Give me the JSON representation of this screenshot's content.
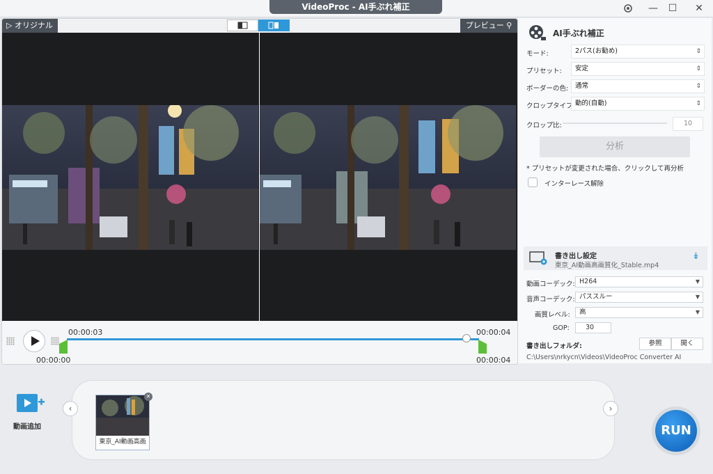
{
  "window": {
    "title": "VideoProc - AI手ぶれ補正"
  },
  "preview": {
    "original_tab": "オリジナル",
    "preview_tab": "プレビュー",
    "current_time": "00:00:03",
    "start_time": "00:00:00",
    "end_time_top": "00:00:04",
    "end_time_bottom": "00:00:04",
    "playhead_fraction": 0.97
  },
  "stabilize": {
    "title": "AI手ぶれ補正",
    "mode_label": "モード:",
    "mode_value": "2パス(お勧め)",
    "preset_label": "プリセット:",
    "preset_value": "安定",
    "border_label": "ボーダーの色:",
    "border_value": "通常",
    "crop_type_label": "クロップタイプ:",
    "crop_type_value": "動的(自動)",
    "crop_ratio_label": "クロップ比:",
    "crop_ratio_value": "10",
    "analyze_label": "分析",
    "note": "* プリセットが変更された場合、クリックして再分析",
    "deinterlace_label": "インターレース解除"
  },
  "export": {
    "title": "書き出し設定",
    "filename": "東京_AI動画高画質化_Stable.mp4",
    "video_codec_label": "動画コーデック:",
    "video_codec_value": "H264",
    "audio_codec_label": "音声コーデック:",
    "audio_codec_value": "パススルー",
    "quality_label": "画質レベル:",
    "quality_value": "高",
    "gop_label": "GOP:",
    "gop_value": "30",
    "folder_label": "書き出しフォルダ:",
    "browse_label": "参照",
    "open_label": "開く",
    "folder_path": "C:\\Users\\nrkycn\\Videos\\VideoProc Converter AI"
  },
  "bottom": {
    "add_video_label": "動画追加",
    "clip_name": "東京_AI動画高画",
    "run_label": "RUN"
  },
  "colors": {
    "accent": "#2f98d8",
    "run": "#0d5fb6",
    "trim": "#5cbf3a"
  }
}
